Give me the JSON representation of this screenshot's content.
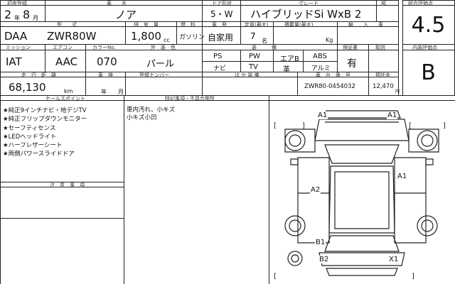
{
  "headers": {
    "first_reg": "初度登録",
    "car_name": "車　　名",
    "doors": "ドア形状",
    "grade": "グレード",
    "site": "部",
    "overall_score": "総合評価点",
    "model": "型　　式",
    "displacement": "排　気　量",
    "fuel": "燃　料",
    "usage": "車　歴",
    "capacity": "定員(最大)",
    "load": "積載量(最大)",
    "import": "輸　　入　　車",
    "mission": "ミッション",
    "aircon": "エアコン",
    "color_no": "カラーNo.",
    "color": "外　装　色",
    "equipment": "装　　　備",
    "warranty": "保証書",
    "recycle": "取説",
    "interior_score": "内装評価点",
    "mileage": "走　行　距　離",
    "inspection": "車　検",
    "prev_plate": "登録ナンバー",
    "other": "ほ か 装 備",
    "frame_no": "車　台　番　号",
    "recycle_fee": "預託金",
    "sales_points": "セールスポイント",
    "notes": "特記事項・不具合箇所",
    "caution": "注　意　事　項"
  },
  "vehicle": {
    "year_era": "2",
    "year_unit": "年",
    "month": "8",
    "month_unit": "月",
    "name": "ノア",
    "doors": "5・W",
    "grade": "ハイブリッドSi WxB 2",
    "model_prefix": "DAA",
    "model": "ZWR80W",
    "displacement": "1,800",
    "cc": "cc",
    "fuel": "ガソリン",
    "usage": "自家用",
    "capacity": "7",
    "capacity_unit": "名",
    "load_unit": "Kg",
    "mission": "IAT",
    "aircon": "AAC",
    "color_no": "070",
    "color": "パール",
    "mileage": "68,130",
    "mileage_unit": "km",
    "inspection_unit_year": "年",
    "inspection_unit_month": "月",
    "frame_no": "ZWR80-0454032",
    "recycle_fee": "12,470",
    "recycle_unit": "円",
    "warranty_value": "有",
    "score": "4.5",
    "interior_score": "B"
  },
  "equipment": [
    [
      "PS",
      "PW",
      "エアB",
      "ABS"
    ],
    [
      "ナビ",
      "TV",
      "革",
      "アルミ"
    ]
  ],
  "sales_points": [
    "★純正9インチナビ・地デジTV",
    "★純正フリップダウンモニター",
    "★セーフティセンス",
    "★LEDヘッドライト",
    "★ハーフレザーシート",
    "★両側パワースライドドア"
  ],
  "notes": [
    "車内汚れ、小キズ",
    "小キズ小凹"
  ],
  "diagram_marks": [
    "A1",
    "A1",
    "A1",
    "A2",
    "B1",
    "B2",
    "X1"
  ]
}
